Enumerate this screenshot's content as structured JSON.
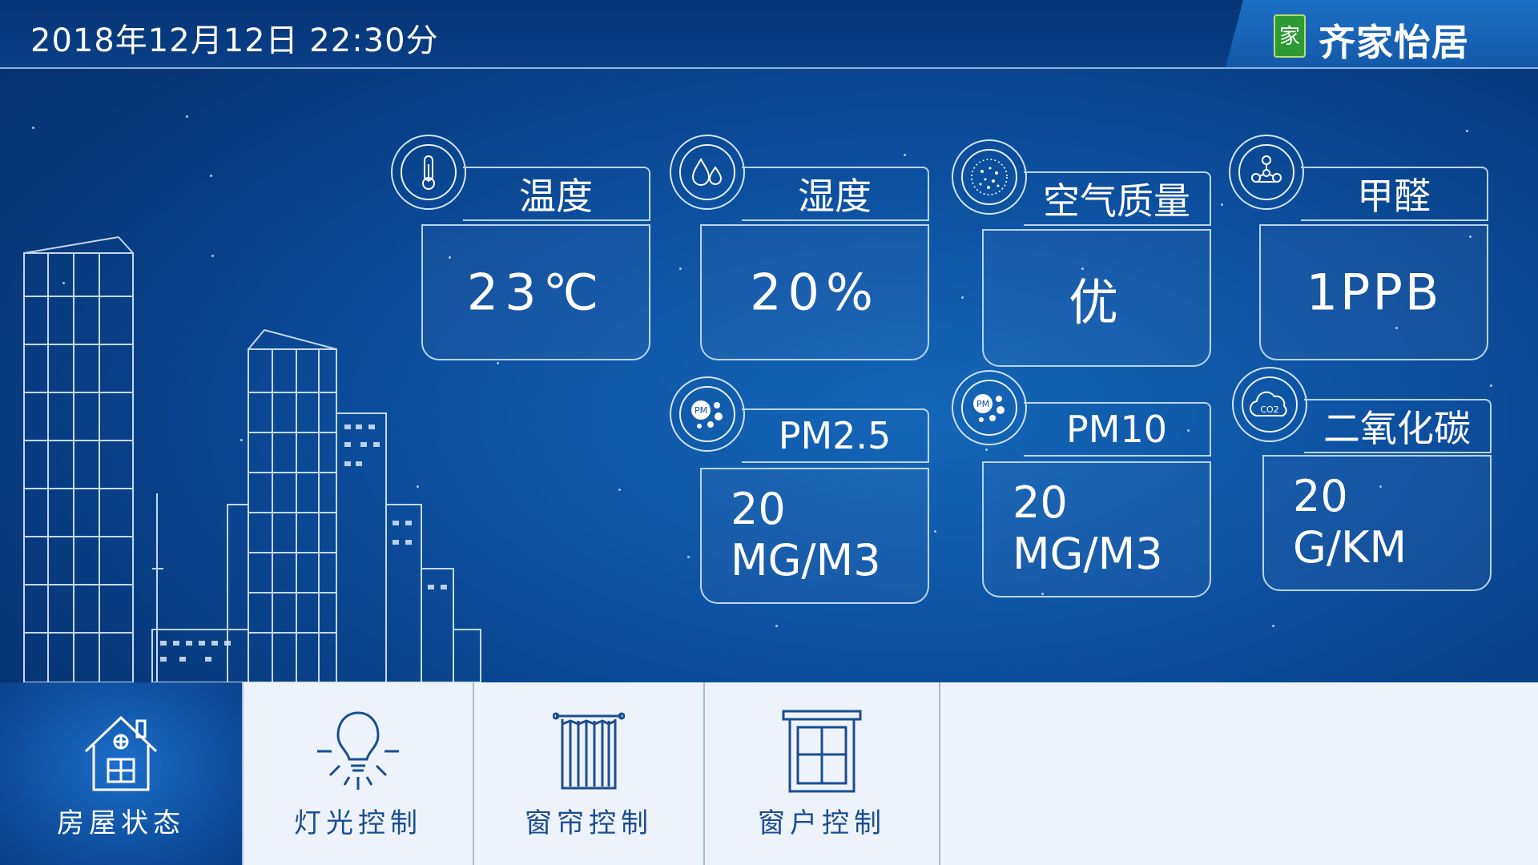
{
  "header": {
    "datetime": "2018年12月12日 22:30分",
    "brand": "齐家怡居",
    "brand_logo_text": "家"
  },
  "sensors": [
    {
      "label": "温度",
      "value": "23℃",
      "icon": "thermometer-icon"
    },
    {
      "label": "湿度",
      "value": "20%",
      "icon": "water-drop-icon"
    },
    {
      "label": "空气质量",
      "value": "优",
      "icon": "air-particles-icon"
    },
    {
      "label": "甲醛",
      "value": "1PPB",
      "icon": "molecule-icon"
    },
    {
      "label": "PM2.5",
      "value": "20",
      "unit": "MG/M3",
      "icon": "pm-icon",
      "icon_text": "PM"
    },
    {
      "label": "PM10",
      "value": "20",
      "unit": "MG/M3",
      "icon": "pm-icon",
      "icon_text": "PM"
    },
    {
      "label": "二氧化碳",
      "value": "20",
      "unit": "G/KM",
      "icon": "co2-cloud-icon",
      "icon_text": "CO2"
    }
  ],
  "nav": [
    {
      "label": "房屋状态",
      "icon": "house-icon",
      "active": true
    },
    {
      "label": "灯光控制",
      "icon": "light-bulb-icon",
      "active": false
    },
    {
      "label": "窗帘控制",
      "icon": "curtain-icon",
      "active": false
    },
    {
      "label": "窗户控制",
      "icon": "window-icon",
      "active": false
    }
  ],
  "colors": {
    "background": "#0d4f9f",
    "topbar": "#063475",
    "brand": "#1d6fc6",
    "bottom_bar": "#eef3fb",
    "nav_text": "#1a4e91"
  }
}
